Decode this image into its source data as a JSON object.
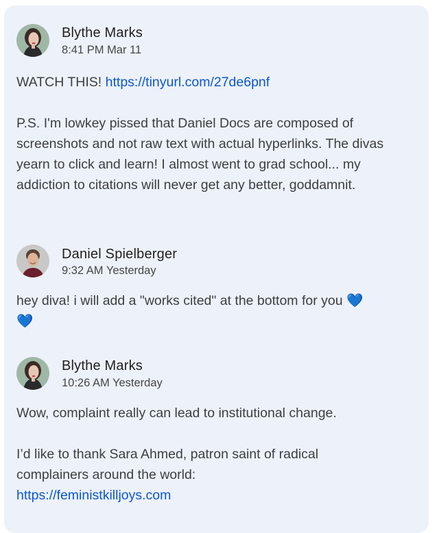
{
  "comments": [
    {
      "author": "Blythe Marks",
      "timestamp": "8:41 PM Mar 11",
      "avatar_icon": "woman-portrait-avatar",
      "p1_text": "WATCH THIS! ",
      "p1_link": "https://tinyurl.com/27de6pnf",
      "p2_text": "P.S. I'm lowkey pissed that Daniel Docs are composed of screenshots and not raw text with actual hyperlinks. The divas yearn to click and learn! I almost went to grad school... my addiction to citations will never get any better, goddamnit."
    },
    {
      "author": "Daniel Spielberger",
      "timestamp": "9:32 AM Yesterday",
      "avatar_icon": "man-portrait-avatar",
      "p1_text": "hey diva! i will add a \"works cited\" at the bottom for you 💙💙"
    },
    {
      "author": "Blythe Marks",
      "timestamp": "10:26 AM Yesterday",
      "avatar_icon": "woman-portrait-avatar",
      "p1_text": "Wow, complaint really can lead to institutional change.",
      "p2_text": "I’d like to thank Sara Ahmed, patron saint of radical complainers around the world:",
      "p2_link": "https://feministkilljoys.com"
    }
  ],
  "colors": {
    "card_background": "#edf1f9",
    "link": "#0b57d0",
    "text": "#3c4043"
  }
}
